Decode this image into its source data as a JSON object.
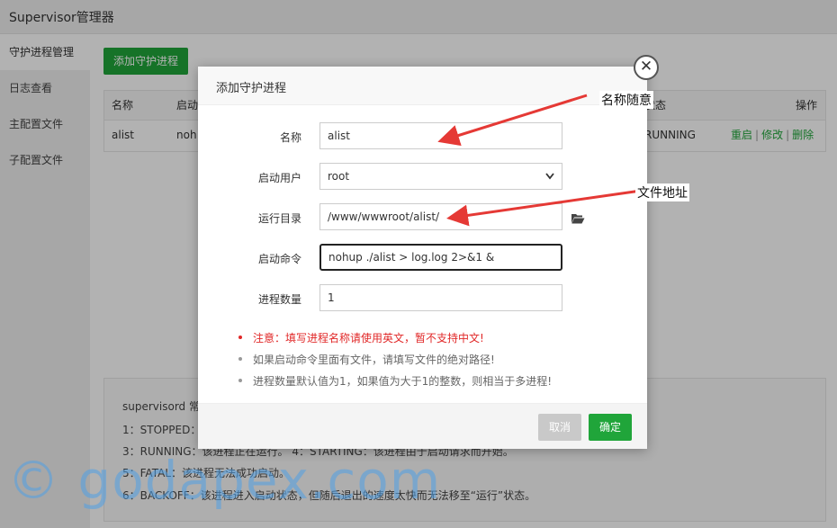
{
  "app": {
    "title": "Supervisor管理器"
  },
  "sidebar": {
    "items": [
      {
        "label": "守护进程管理"
      },
      {
        "label": "日志查看"
      },
      {
        "label": "主配置文件"
      },
      {
        "label": "子配置文件"
      }
    ]
  },
  "toolbar": {
    "add_label": "添加守护进程"
  },
  "table": {
    "headers": {
      "name": "名称",
      "user": "启动",
      "status": "状态",
      "action": "操作"
    },
    "rows": [
      {
        "name": "alist",
        "user": "noh",
        "status": "RUNNING",
        "restart": "重启",
        "edit": "修改",
        "delete": "删除",
        "sep": "|"
      }
    ]
  },
  "help": {
    "lines": [
      "supervisord 常",
      "1：STOPPED：",
      "3：RUNNING：该进程正在运行。  4：STARTING：该进程由于启动请求而开始。",
      "5：FATAL：该进程无法成功启动。",
      "6：BACKOFF：该进程进入启动状态，但随后退出的速度太快而无法移至“运行”状态。"
    ]
  },
  "dialog": {
    "title": "添加守护进程",
    "close_glyph": "✕",
    "fields": {
      "name": {
        "label": "名称",
        "value": "alist"
      },
      "user": {
        "label": "启动用户",
        "value": "root"
      },
      "dir": {
        "label": "运行目录",
        "value": "/www/wwwroot/alist/"
      },
      "cmd": {
        "label": "启动命令",
        "value": "nohup ./alist > log.log 2>&1 &"
      },
      "count": {
        "label": "进程数量",
        "value": "1"
      }
    },
    "notes": [
      "注意：填写进程名称请使用英文，暂不支持中文!",
      "如果启动命令里面有文件，请填写文件的绝对路径!",
      "进程数量默认值为1，如果值为大于1的整数，则相当于多进程!"
    ],
    "cancel_label": "取消",
    "ok_label": "确定"
  },
  "annotations": {
    "name_hint": "名称随意",
    "dir_hint": "文件地址"
  },
  "watermark": "© godapex.com",
  "colors": {
    "accent": "#20a53a",
    "warning": "#e12828",
    "arrow": "#e53935"
  },
  "icons": {
    "folder": "folder-open-icon",
    "chevron": "chevron-down-icon",
    "close": "close-icon"
  }
}
